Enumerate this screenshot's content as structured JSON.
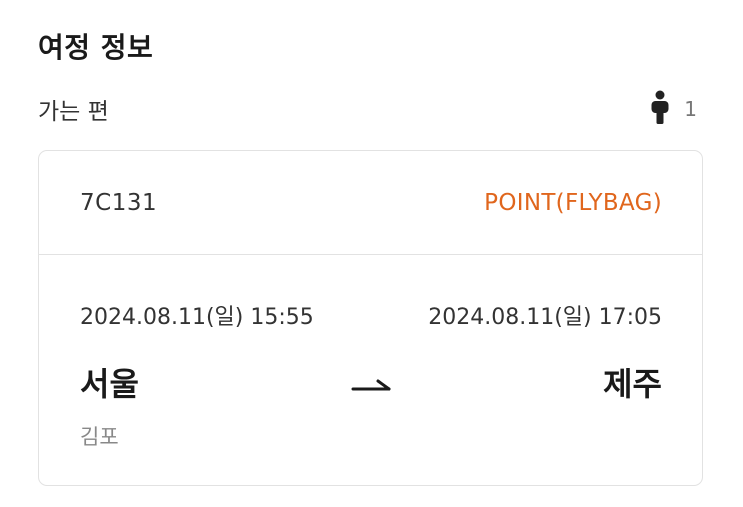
{
  "itinerary": {
    "title": "여정 정보",
    "leg_label": "가는 편",
    "passenger_count": "1",
    "passenger_icon": "person-icon",
    "arrow_icon": "arrow-right-icon",
    "accent_color": "#e0661d",
    "flight": {
      "number": "7C131",
      "fare": "POINT(FLYBAG)",
      "departure": {
        "datetime": "2024.08.11(일) 15:55",
        "city": "서울",
        "airport": "김포"
      },
      "arrival": {
        "datetime": "2024.08.11(일) 17:05",
        "city": "제주"
      }
    }
  }
}
